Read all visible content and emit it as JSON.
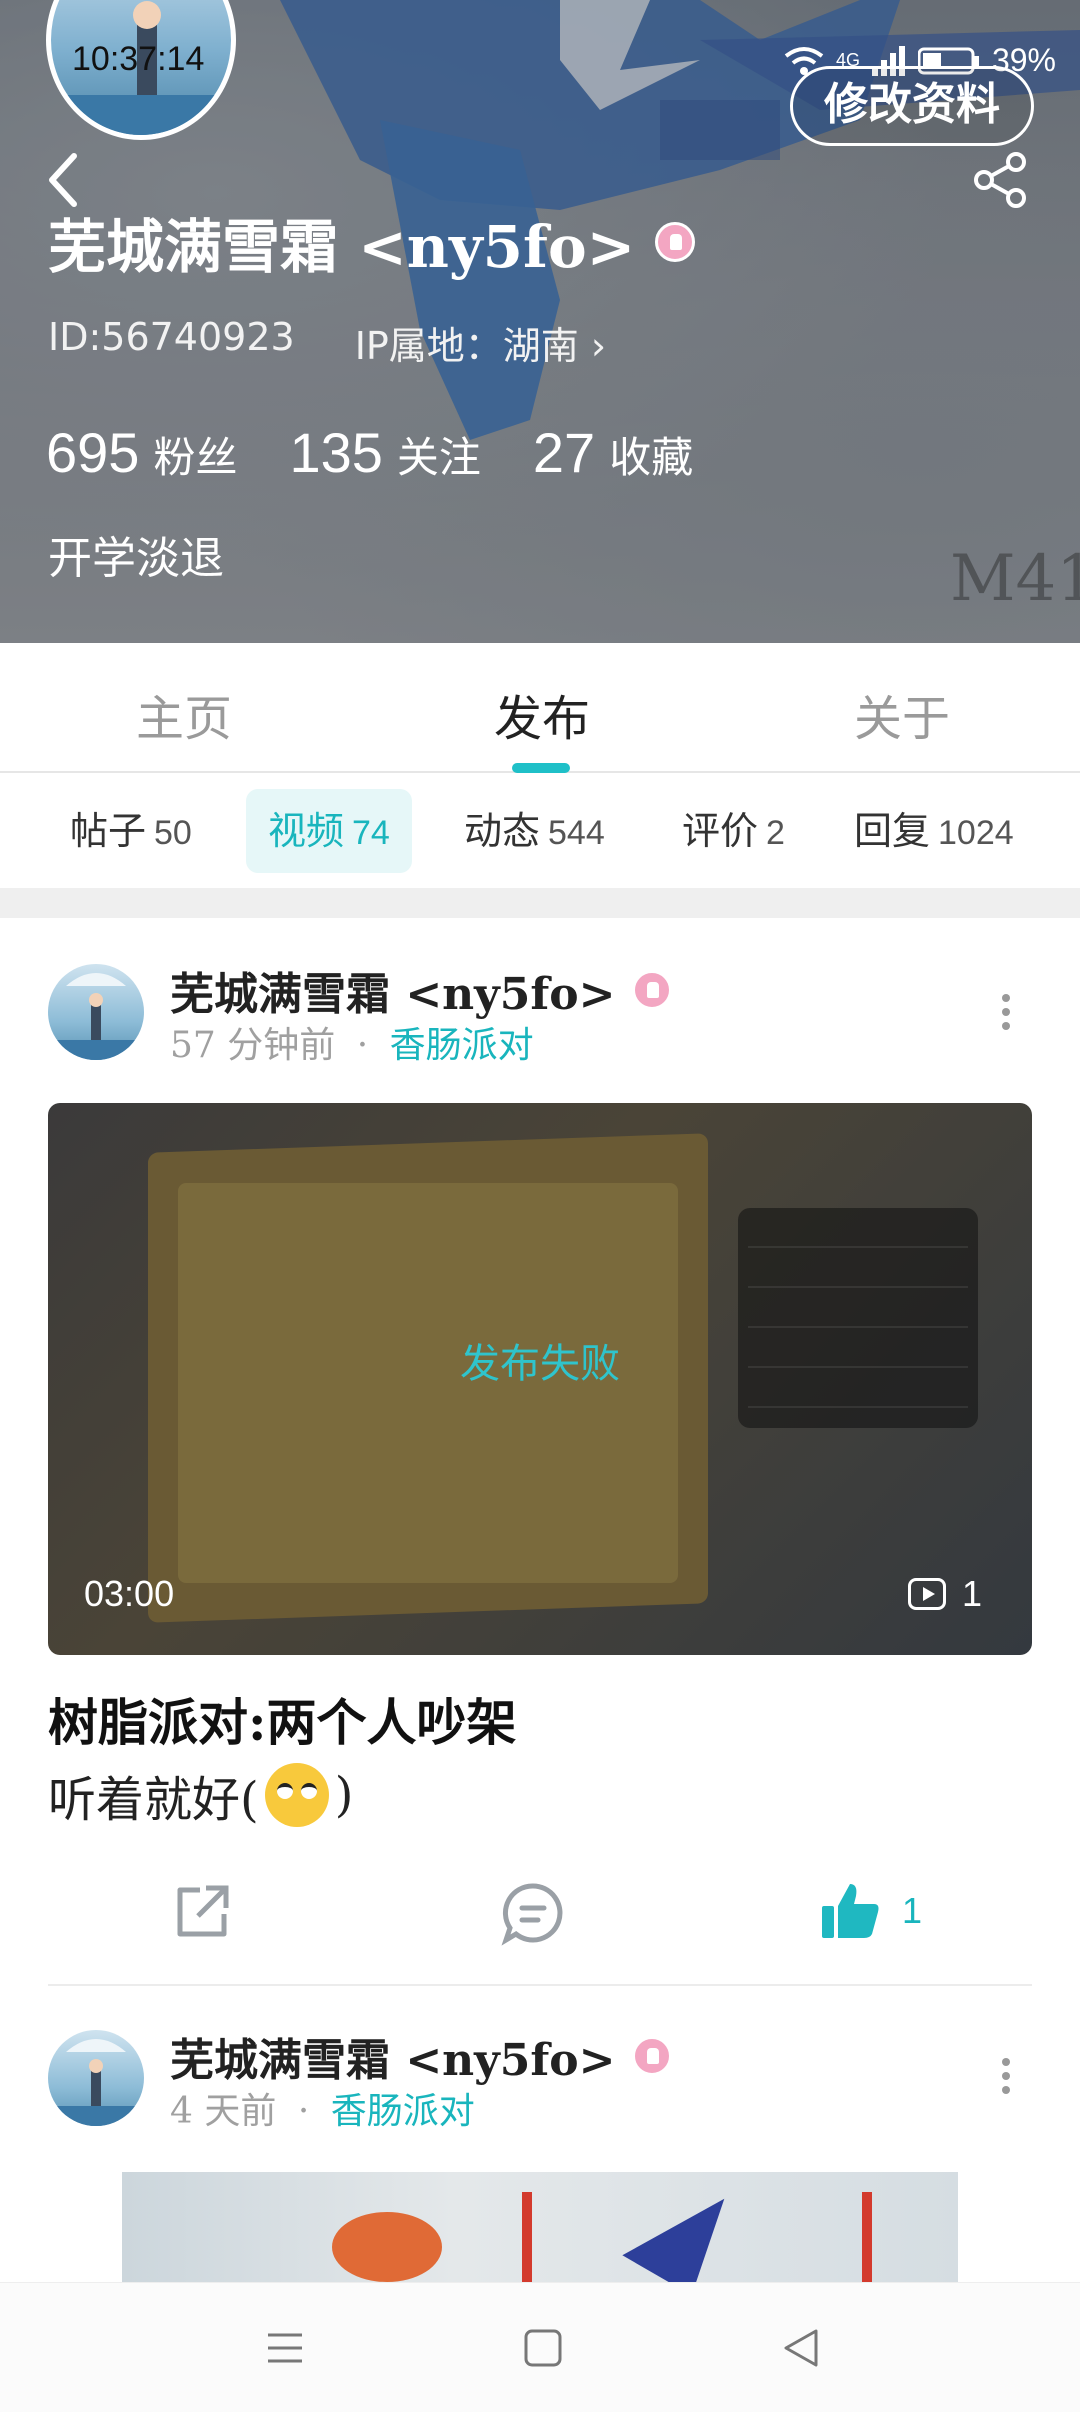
{
  "status_bar": {
    "time": "10:37:14",
    "battery": "39%",
    "network": "4G"
  },
  "header": {
    "edit_button": "修改资料",
    "username": "芜城满雪霜 <ny5fo>",
    "id_text": "ID:56740923",
    "ip_location": "IP属地：湖南 ›",
    "stats": [
      {
        "value": "695",
        "label": "粉丝"
      },
      {
        "value": "135",
        "label": "关注"
      },
      {
        "value": "27",
        "label": "收藏"
      }
    ],
    "bio": "开学淡退",
    "art_text": "M41"
  },
  "main_tabs": [
    {
      "label": "主页",
      "active": false
    },
    {
      "label": "发布",
      "active": true
    },
    {
      "label": "关于",
      "active": false
    }
  ],
  "sub_tabs": [
    {
      "label": "帖子",
      "count": "50",
      "active": false
    },
    {
      "label": "视频",
      "count": "74",
      "active": true
    },
    {
      "label": "动态",
      "count": "544",
      "active": false
    },
    {
      "label": "评价",
      "count": "2",
      "active": false
    },
    {
      "label": "回复",
      "count": "1024",
      "active": false
    }
  ],
  "posts": [
    {
      "author": "芜城满雪霜 <ny5fo>",
      "time": "57 分钟前",
      "dot": "·",
      "topic": "香肠派对",
      "video_status": "发布失败",
      "duration": "03:00",
      "video_count": "1",
      "title": "树脂派对:两个人吵架",
      "body_before": "听着就好(",
      "body_after": ")",
      "likes": "1"
    },
    {
      "author": "芜城满雪霜 <ny5fo>",
      "time": "4 天前",
      "dot": "·",
      "topic": "香肠派对"
    }
  ],
  "colors": {
    "accent": "#19b5bd",
    "badge": "#f3a6c2",
    "like": "#1fb8c1"
  },
  "icons": {
    "back": "back-arrow-icon",
    "share": "share-icon",
    "more": "more-vertical-icon",
    "forward": "share-out-icon",
    "comment": "comment-icon",
    "like": "thumbs-up-icon",
    "nav_menu": "menu-icon",
    "nav_home": "home-icon",
    "nav_back": "back-triangle-icon"
  }
}
